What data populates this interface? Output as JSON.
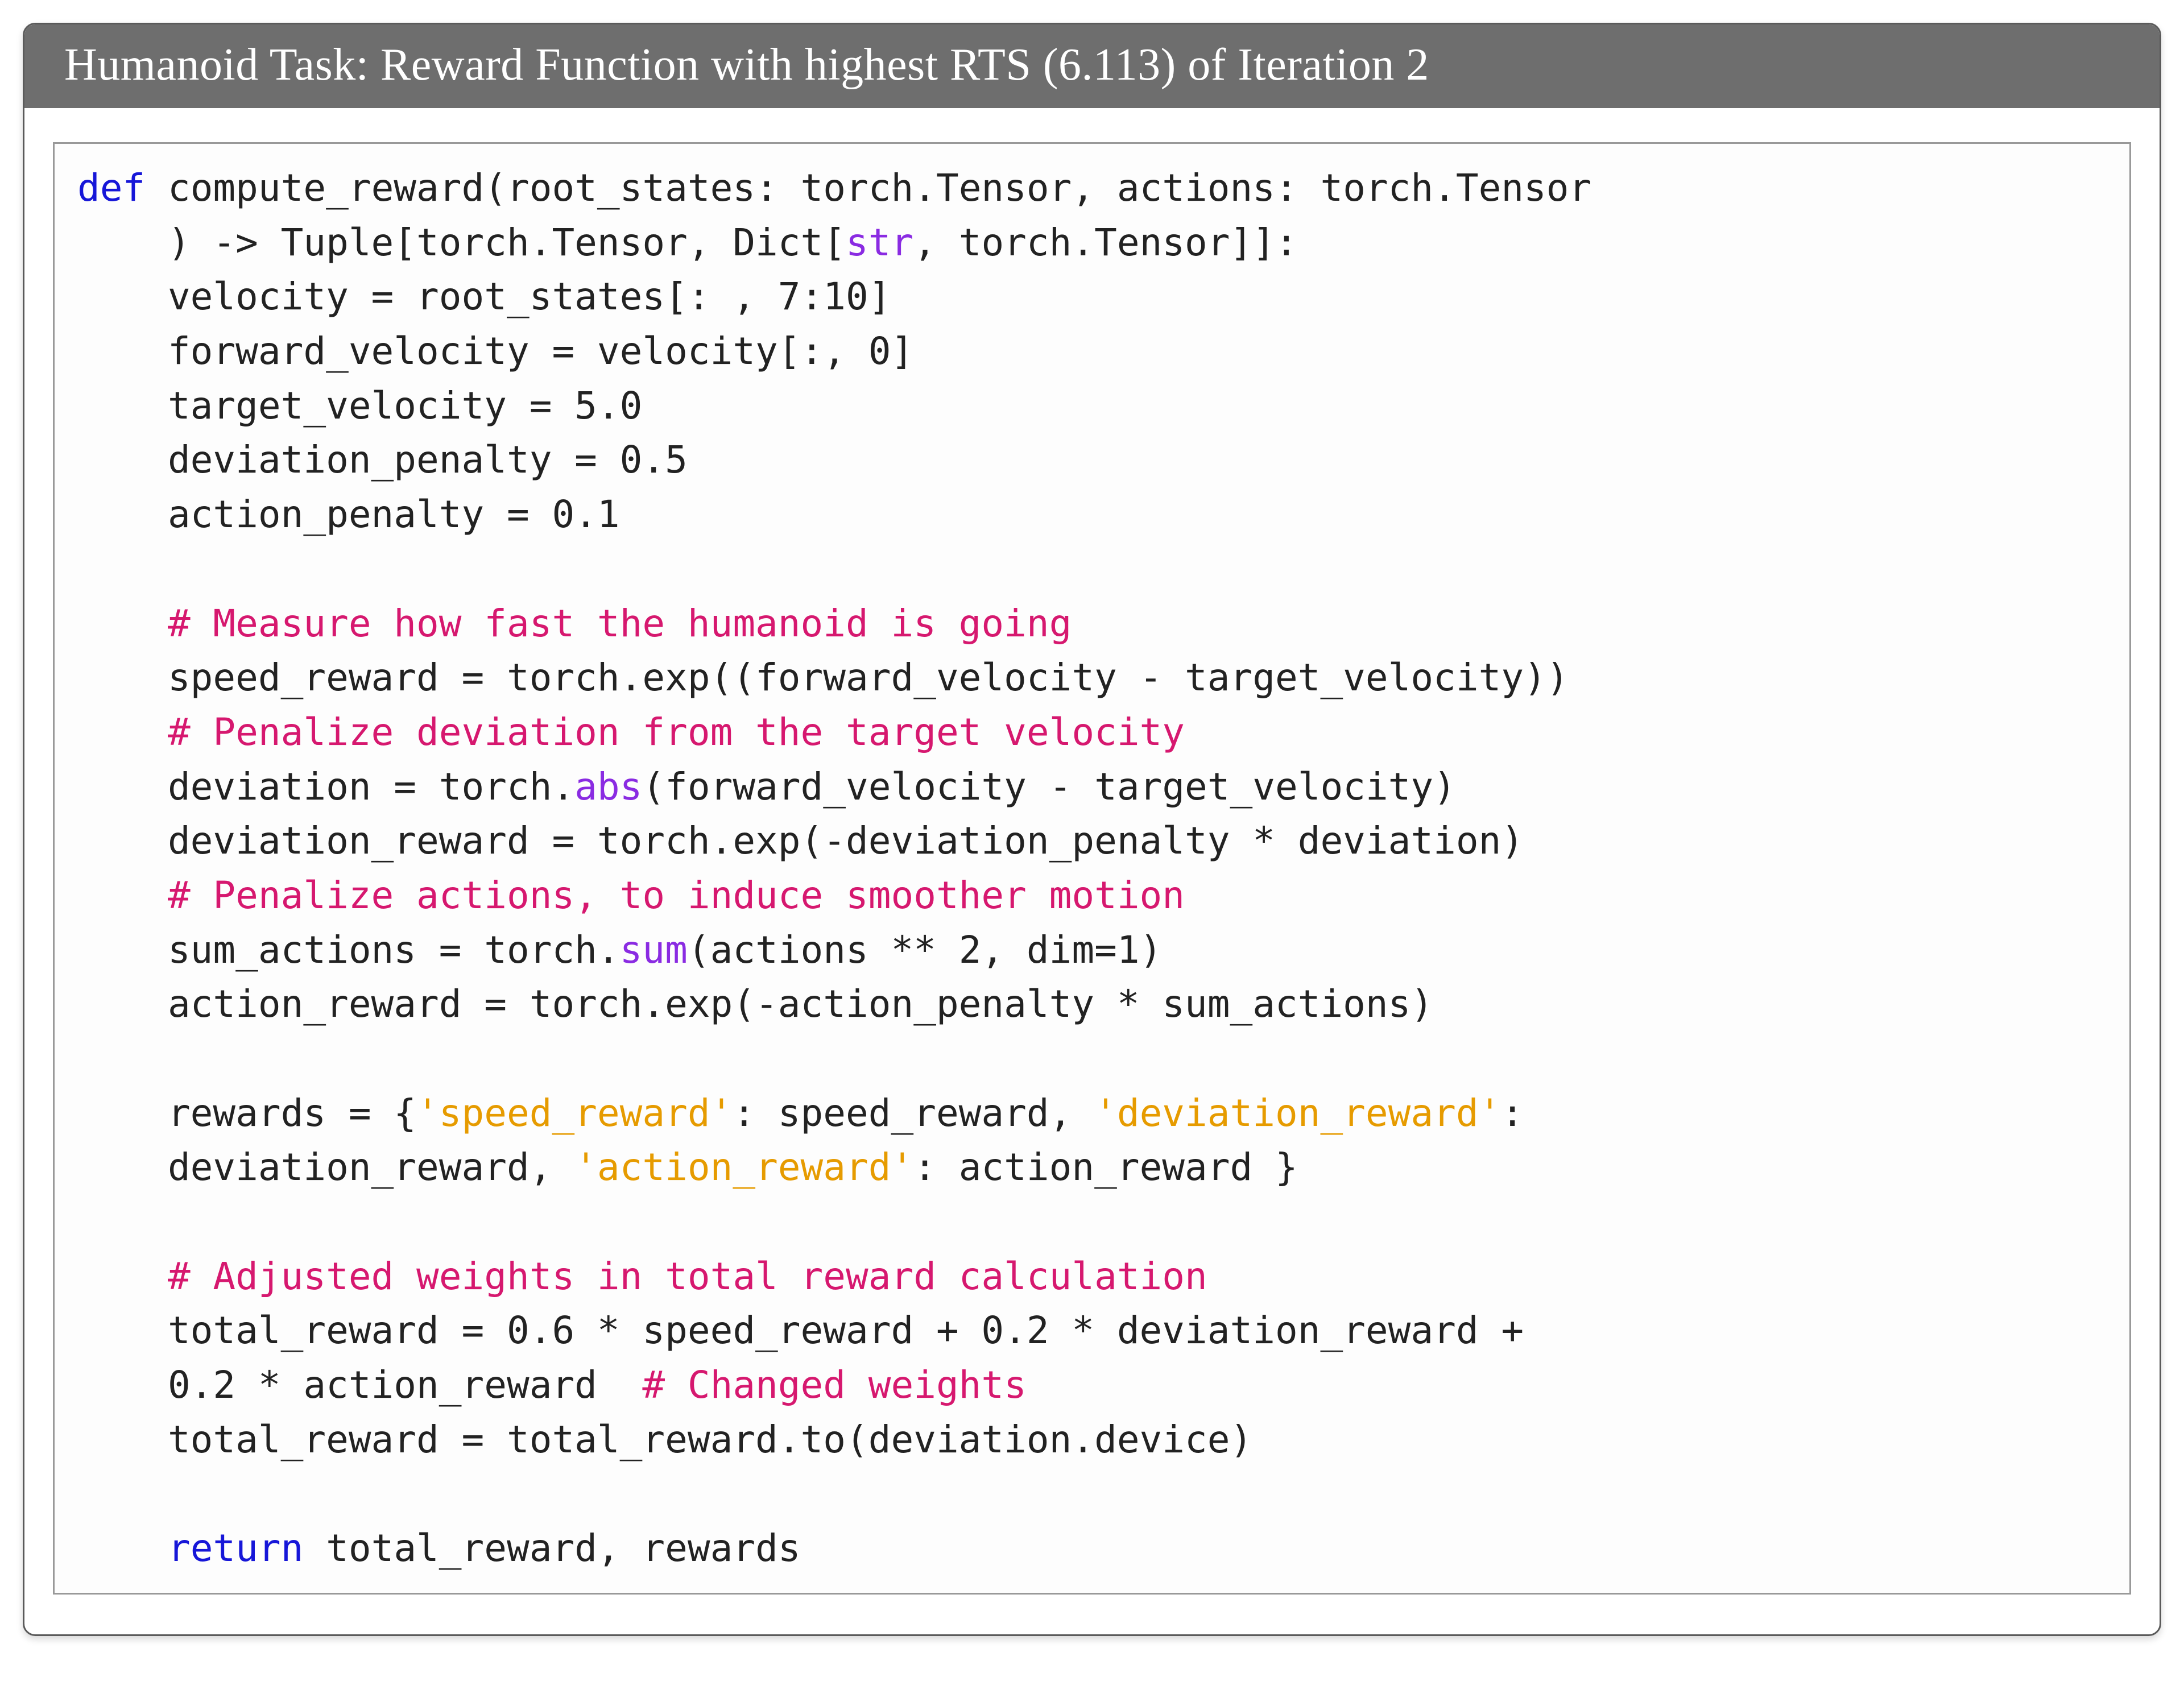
{
  "header": {
    "title": "Humanoid Task: Reward Function with highest RTS (6.113) of Iteration 2"
  },
  "code": {
    "l01a": "def",
    "l01b": " compute_reward(root_states: torch.Tensor, actions: torch.Tensor",
    "l02a": "    ) -> Tuple[torch.Tensor, Dict[",
    "l02b": "str",
    "l02c": ", torch.Tensor]]:",
    "l03": "    velocity = root_states[: , 7:10]",
    "l04": "    forward_velocity = velocity[:, 0]",
    "l05": "    target_velocity = 5.0",
    "l06": "    deviation_penalty = 0.5",
    "l07": "    action_penalty = 0.1",
    "l08": "",
    "l09": "    # Measure how fast the humanoid is going",
    "l10": "    speed_reward = torch.exp((forward_velocity - target_velocity))",
    "l11": "    # Penalize deviation from the target velocity",
    "l12a": "    deviation = torch.",
    "l12b": "abs",
    "l12c": "(forward_velocity - target_velocity)",
    "l13": "    deviation_reward = torch.exp(-deviation_penalty * deviation)",
    "l14": "    # Penalize actions, to induce smoother motion",
    "l15a": "    sum_actions = torch.",
    "l15b": "sum",
    "l15c": "(actions ** 2, dim=1)",
    "l16": "    action_reward = torch.exp(-action_penalty * sum_actions)",
    "l17": "",
    "l18a": "    rewards = {",
    "l18b": "'speed_reward'",
    "l18c": ": speed_reward, ",
    "l18d": "'deviation_reward'",
    "l18e": ":",
    "l19a": "    deviation_reward, ",
    "l19b": "'action_reward'",
    "l19c": ": action_reward }",
    "l20": "",
    "l21": "    # Adjusted weights in total reward calculation",
    "l22": "    total_reward = 0.6 * speed_reward + 0.2 * deviation_reward +",
    "l23a": "    0.2 * action_reward  ",
    "l23b": "# Changed weights",
    "l24": "    total_reward = total_reward.to(deviation.device)",
    "l25": "",
    "l26a": "    ",
    "l26b": "return",
    "l26c": " total_reward, rewards"
  }
}
